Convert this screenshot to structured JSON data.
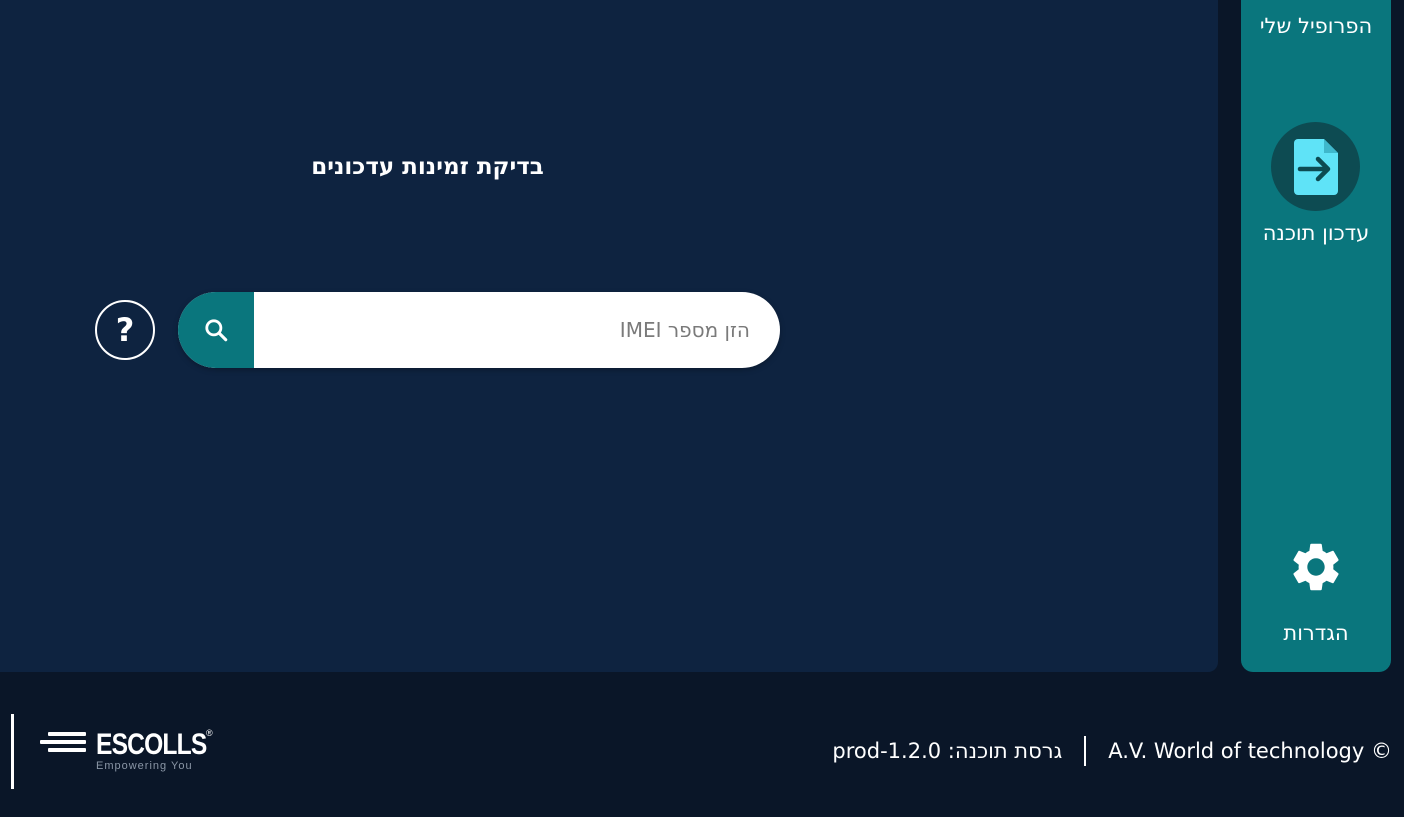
{
  "main": {
    "title": "בדיקת זמינות עדכונים",
    "search": {
      "placeholder": "הזן מספר IMEI",
      "value": ""
    },
    "help_label": "?"
  },
  "sidebar": {
    "items": [
      {
        "label": "הפרופיל שלי",
        "icon": "user-icon"
      },
      {
        "label": "עדכון תוכנה",
        "icon": "file-update-icon"
      },
      {
        "label": "הגדרות",
        "icon": "gear-icon"
      }
    ]
  },
  "footer": {
    "copyright": "© A.V. World of technology",
    "version": "גרסת תוכנה: prod-1.2.0",
    "logo": {
      "name": "ESCOLLS",
      "registered": "®",
      "tagline": "Empowering You"
    }
  },
  "colors": {
    "background": "#0a1628",
    "panel": "#0e2340",
    "accent_teal": "#0a767d",
    "icon_cyan": "#5fe3f7"
  }
}
